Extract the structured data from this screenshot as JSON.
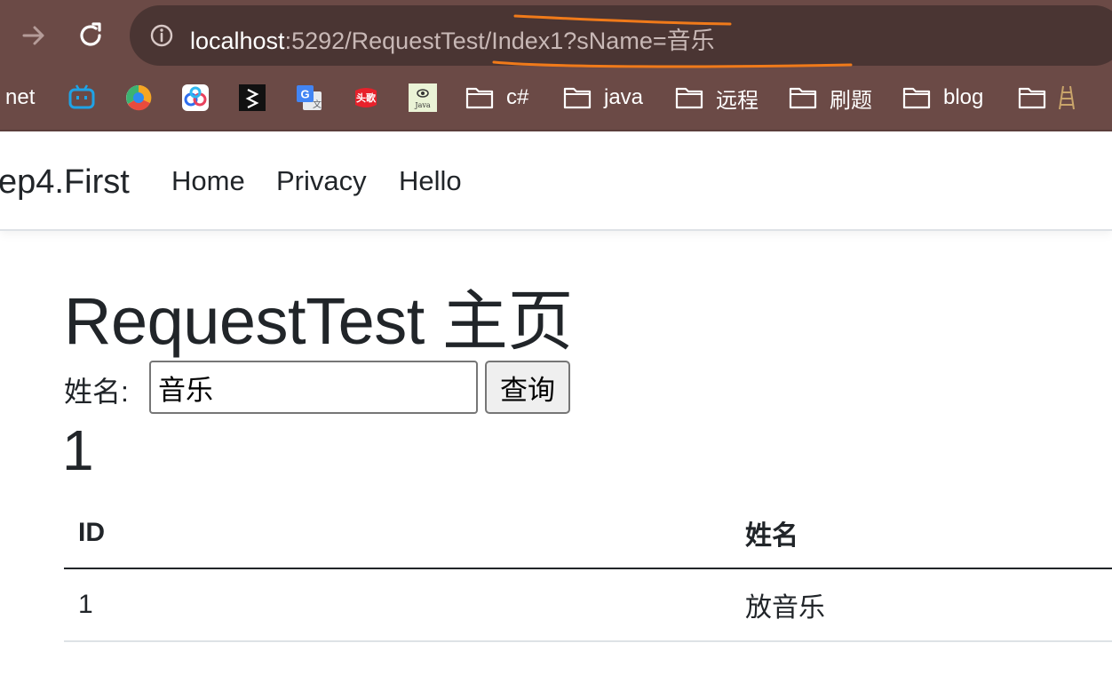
{
  "browser": {
    "url_host": "localhost",
    "url_rest": ":5292/RequestTest/Index1?sName=音乐",
    "bookmarks": [
      {
        "label": "net",
        "icon": "bookmark-net"
      },
      {
        "label": "",
        "icon": "bilibili-icon"
      },
      {
        "label": "",
        "icon": "browser-logo-icon"
      },
      {
        "label": "",
        "icon": "baidu-netdisk-icon"
      },
      {
        "label": "",
        "icon": "fx-logo-icon"
      },
      {
        "label": "",
        "icon": "google-translate-icon"
      },
      {
        "label": "",
        "icon": "toutiao-icon"
      },
      {
        "label": "",
        "icon": "java-logo-icon"
      },
      {
        "label": "c#",
        "icon": "folder-icon"
      },
      {
        "label": "java",
        "icon": "folder-icon"
      },
      {
        "label": "远程",
        "icon": "folder-icon"
      },
      {
        "label": "刷题",
        "icon": "folder-icon"
      },
      {
        "label": "blog",
        "icon": "folder-icon"
      },
      {
        "label": "",
        "icon": "folder-icon"
      }
    ],
    "toutiao_text": "头歌",
    "java_text": "Java"
  },
  "navbar": {
    "brand": "ep4.First",
    "links": [
      "Home",
      "Privacy",
      "Hello"
    ]
  },
  "main": {
    "title": "RequestTest 主页",
    "form": {
      "label": "姓名:",
      "input_value": "音乐",
      "button_label": "查询"
    },
    "count": "1",
    "table": {
      "headers": [
        "ID",
        "姓名"
      ],
      "rows": [
        [
          "1",
          "放音乐"
        ]
      ]
    }
  },
  "colors": {
    "chrome_bg": "#6b4a46",
    "omnibox_bg": "#4a3533",
    "annotation_stroke": "#f07a1a"
  }
}
